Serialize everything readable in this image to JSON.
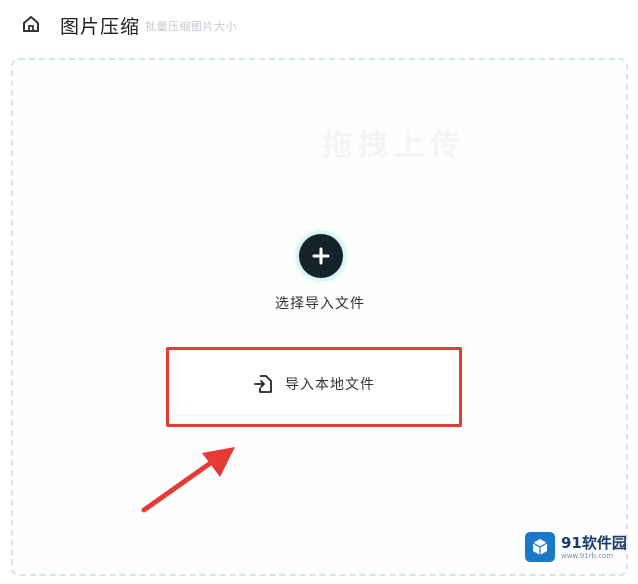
{
  "header": {
    "title": "图片压缩",
    "subtitle": "批量压缩图片大小",
    "home_icon": "home-icon"
  },
  "dropzone": {
    "ghost_text": "拖拽上传",
    "add_icon": "plus-icon",
    "select_label": "选择导入文件",
    "import_icon": "file-import-icon",
    "import_label": "导入本地文件"
  },
  "annotation": {
    "highlight_color": "#e53b34",
    "arrow_color": "#e53b34"
  },
  "watermark": {
    "brand": "91软件园",
    "url": "www.91rb.com",
    "logo_icon": "cube-logo-icon",
    "color": "#1a78c8"
  },
  "colors": {
    "accent_glow": "#7de6cd",
    "dark_button": "#16222a",
    "dashed_border": "#d3e8e4"
  }
}
